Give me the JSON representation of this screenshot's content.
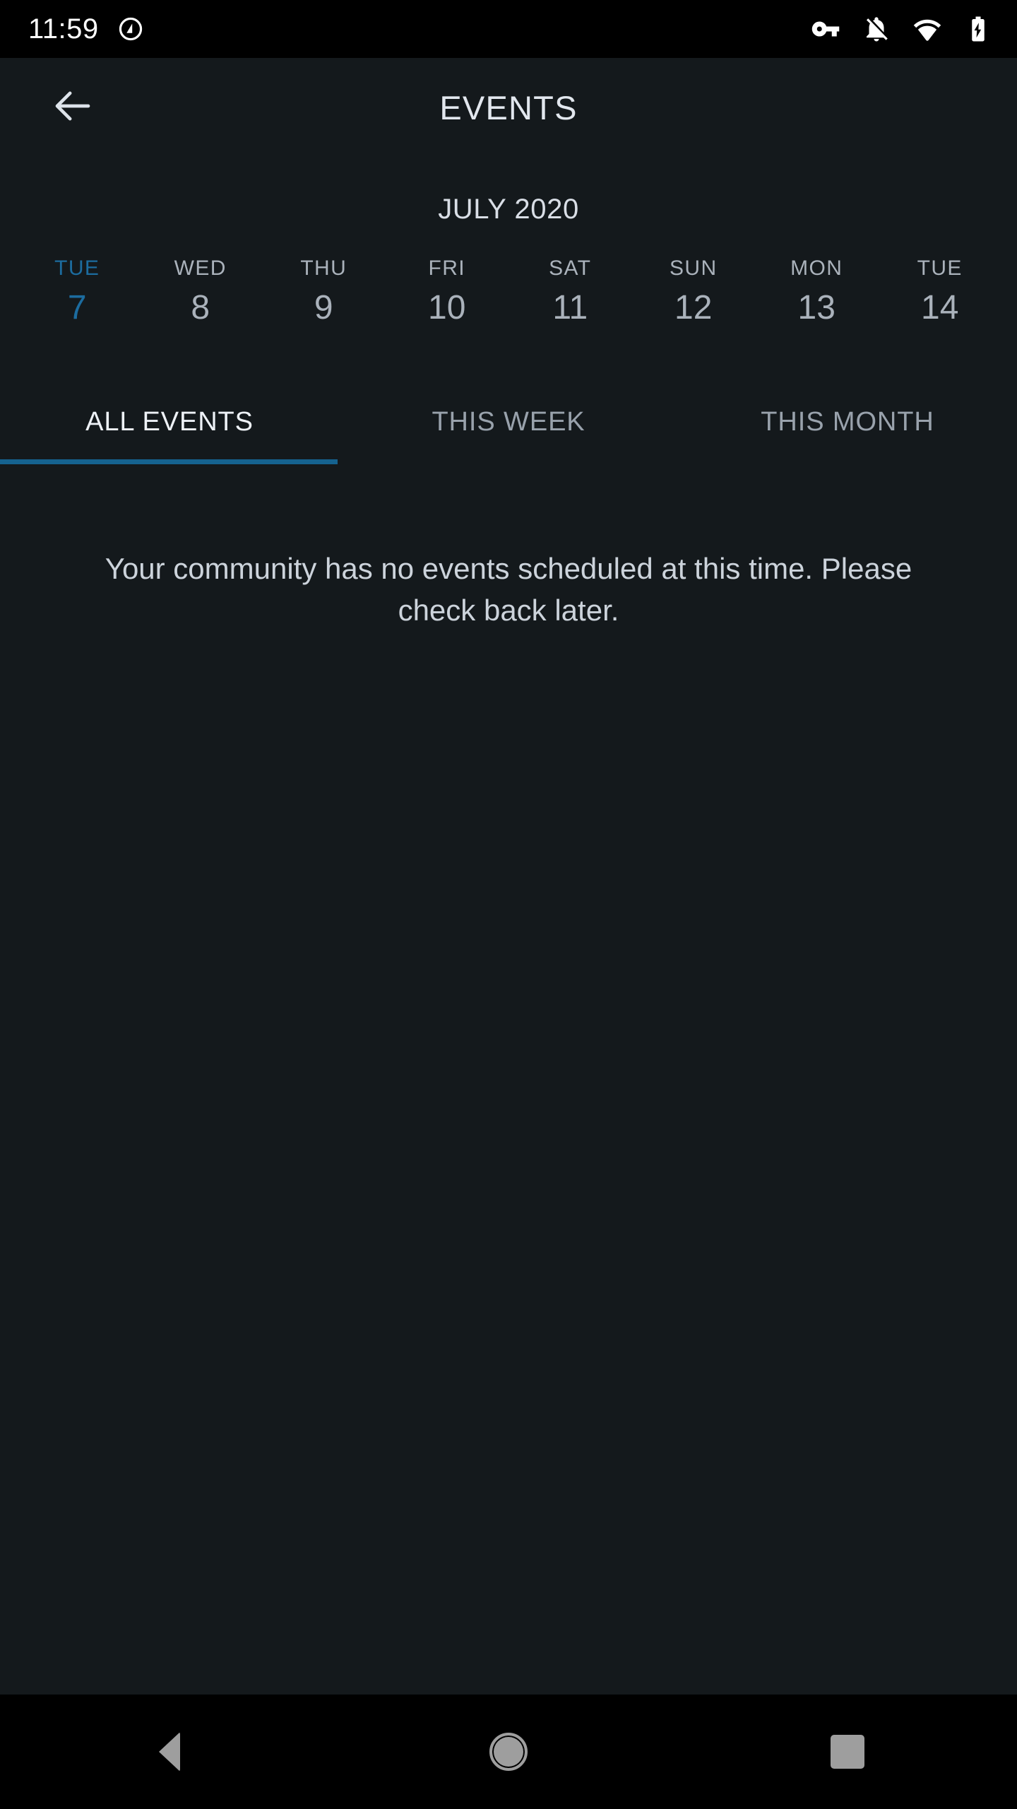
{
  "status_bar": {
    "time": "11:59",
    "left_icons": [
      {
        "name": "android-q-circle-icon"
      }
    ],
    "right_icons": [
      {
        "name": "vpn-key-icon"
      },
      {
        "name": "notifications-off-icon"
      },
      {
        "name": "wifi-icon"
      },
      {
        "name": "battery-charging-icon"
      }
    ]
  },
  "header": {
    "back_icon": "arrow-back-icon",
    "title": "EVENTS"
  },
  "calendar": {
    "month_label": "JULY 2020",
    "days": [
      {
        "dow": "TUE",
        "num": "7",
        "selected": true
      },
      {
        "dow": "WED",
        "num": "8",
        "selected": false
      },
      {
        "dow": "THU",
        "num": "9",
        "selected": false
      },
      {
        "dow": "FRI",
        "num": "10",
        "selected": false
      },
      {
        "dow": "SAT",
        "num": "11",
        "selected": false
      },
      {
        "dow": "SUN",
        "num": "12",
        "selected": false
      },
      {
        "dow": "MON",
        "num": "13",
        "selected": false
      },
      {
        "dow": "TUE",
        "num": "14",
        "selected": false
      }
    ]
  },
  "tabs": [
    {
      "label": "ALL EVENTS",
      "active": true
    },
    {
      "label": "THIS WEEK",
      "active": false
    },
    {
      "label": "THIS MONTH",
      "active": false
    }
  ],
  "content": {
    "empty_message": "Your community has no events scheduled at this time. Please check back later."
  },
  "nav_bar": {
    "back_label": "back-triangle-icon",
    "home_label": "home-circle-icon",
    "recents_label": "recents-square-icon"
  },
  "colors": {
    "background": "#14191c",
    "status_bar": "#000000",
    "accent": "#1c6c9f",
    "tab_indicator": "#15628f",
    "text_primary": "#e2e7ee",
    "text_secondary": "#aab2bb",
    "text_muted": "#99a2ac"
  }
}
